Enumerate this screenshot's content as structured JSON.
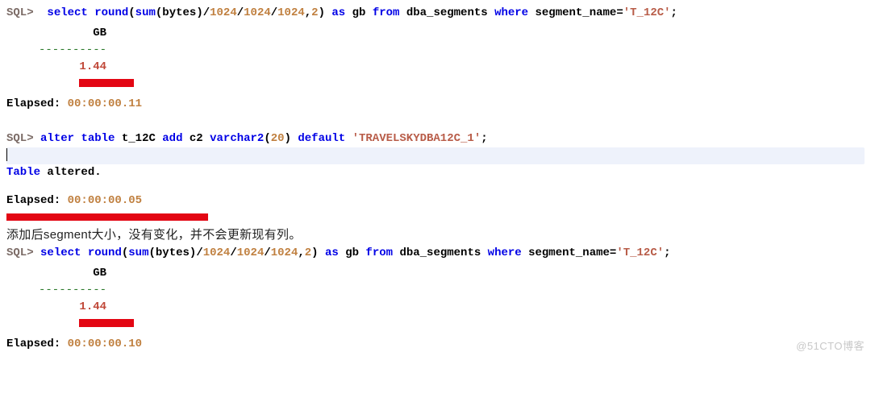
{
  "q1": {
    "prompt": "SQL>",
    "kw_select": "select",
    "fn_round": "round",
    "lp1": "(",
    "fn_sum": "sum",
    "lp2": "(",
    "col_bytes": "bytes",
    "rp2": ")",
    "slash1": "/",
    "n1024a": "1024",
    "slash2": "/",
    "n1024b": "1024",
    "slash3": "/",
    "n1024c": "1024",
    "comma": ",",
    "n2": "2",
    "rp1": ")",
    "kw_as": "as",
    "alias": "gb",
    "kw_from": "from",
    "table": "dba_segments",
    "kw_where": "where",
    "col_seg": "segment_name",
    "eq": "=",
    "str": "'T_12C'",
    "semi": ";"
  },
  "r1": {
    "col_header": "GB",
    "dashes": "----------",
    "value": "1.44",
    "elapsed_label": "Elapsed:",
    "elapsed_time": "00:00:00.11"
  },
  "q2": {
    "prompt": "SQL>",
    "kw_alter": "alter",
    "kw_table": "table",
    "tname": "t_12C",
    "kw_add": "add",
    "col": "c2",
    "type": "varchar2",
    "lp": "(",
    "len": "20",
    "rp": ")",
    "kw_default": "default",
    "str": "'TRAVELSKYDBA12C_1'",
    "semi": ";"
  },
  "r2": {
    "msg1": "Table",
    "msg2": "altered.",
    "elapsed_label": "Elapsed:",
    "elapsed_time": "00:00:00.05"
  },
  "comment": "添加后segment大小，没有变化，并不会更新现有列。",
  "q3": {
    "prompt": "SQL>",
    "kw_select": "select",
    "fn_round": "round",
    "lp1": "(",
    "fn_sum": "sum",
    "lp2": "(",
    "col_bytes": "bytes",
    "rp2": ")",
    "slash1": "/",
    "n1024a": "1024",
    "slash2": "/",
    "n1024b": "1024",
    "slash3": "/",
    "n1024c": "1024",
    "comma": ",",
    "n2": "2",
    "rp1": ")",
    "kw_as": "as",
    "alias": "gb",
    "kw_from": "from",
    "table": "dba_segments",
    "kw_where": "where",
    "col_seg": "segment_name",
    "eq": "=",
    "str": "'T_12C'",
    "semi": ";"
  },
  "r3": {
    "col_header": "GB",
    "dashes": "----------",
    "value": "1.44",
    "elapsed_label": "Elapsed:",
    "elapsed_time": "00:00:00.10"
  },
  "watermark": "@51CTO博客"
}
